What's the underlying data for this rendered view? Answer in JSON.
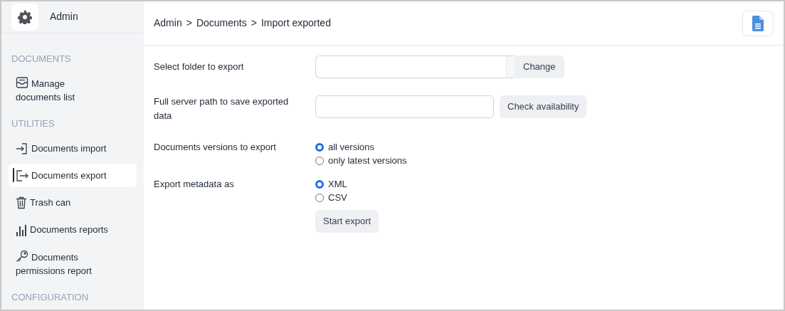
{
  "app": {
    "title": "Admin"
  },
  "sidebar": {
    "items": [
      {
        "kind": "section",
        "label": "DOCUMENTS"
      },
      {
        "kind": "item",
        "label": "Manage documents list",
        "selected": false
      },
      {
        "kind": "section",
        "label": "UTILITIES"
      },
      {
        "kind": "item",
        "label": "Documents import",
        "selected": false
      },
      {
        "kind": "item",
        "label": "Documents export",
        "selected": true
      },
      {
        "kind": "item",
        "label": "Trash can",
        "selected": false
      },
      {
        "kind": "item",
        "label": "Documents reports",
        "selected": false
      },
      {
        "kind": "item",
        "label": "Documents permissions report",
        "selected": false
      },
      {
        "kind": "section",
        "label": "CONFIGURATION"
      }
    ]
  },
  "breadcrumb": {
    "separator": ">",
    "items": [
      "Admin",
      "Documents",
      "Import exported"
    ]
  },
  "form": {
    "rows": [
      {
        "kind": "input_addon",
        "label": "Select folder to export",
        "button": "Change"
      },
      {
        "kind": "input_button",
        "label": "Full server path to save exported data",
        "button": "Check availability"
      },
      {
        "kind": "radio",
        "label": "Documents versions to export",
        "options": [
          {
            "label": "all versions",
            "selected": true
          },
          {
            "label": "only latest versions",
            "selected": false
          }
        ]
      },
      {
        "kind": "radio",
        "label": "Export metadata as",
        "options": [
          {
            "label": "XML",
            "selected": true
          },
          {
            "label": "CSV",
            "selected": false
          }
        ]
      },
      {
        "kind": "submit",
        "button": "Start export"
      }
    ]
  }
}
